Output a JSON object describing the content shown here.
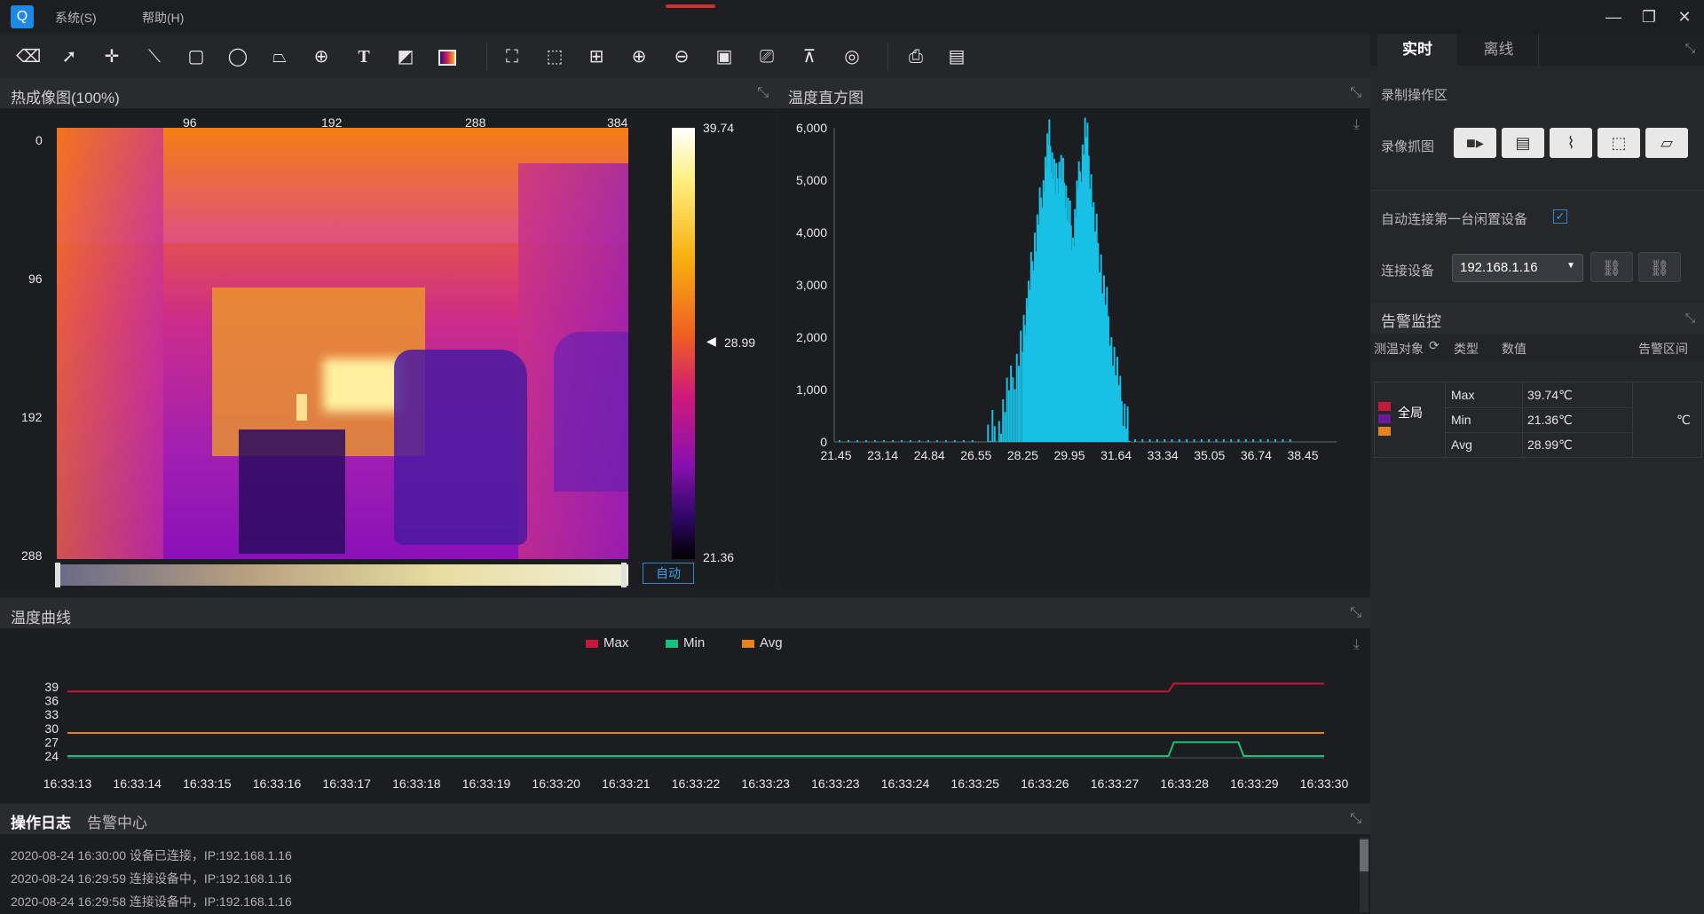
{
  "menu": {
    "system": "系统(S)",
    "help": "帮助(H)"
  },
  "window_controls": {
    "minimize": "—",
    "restore": "❐",
    "close": "✕"
  },
  "thermal": {
    "title": "热成像图(100%)",
    "x_ticks": [
      "96",
      "192",
      "288",
      "384"
    ],
    "y_ticks": [
      "0",
      "96",
      "192",
      "288"
    ],
    "scale_max": "39.74",
    "scale_cursor": "28.99",
    "scale_min": "21.36",
    "auto_button": "自动"
  },
  "histogram": {
    "title": "温度直方图",
    "y_ticks": [
      "6,000",
      "5,000",
      "4,000",
      "3,000",
      "2,000",
      "1,000",
      "0"
    ],
    "x_ticks": [
      "21.45",
      "23.14",
      "24.84",
      "26.55",
      "28.25",
      "29.95",
      "31.64",
      "33.34",
      "35.05",
      "36.74",
      "38.45"
    ]
  },
  "curve": {
    "title": "温度曲线",
    "legend": [
      {
        "name": "Max",
        "color": "#c8173a"
      },
      {
        "name": "Min",
        "color": "#14c47a"
      },
      {
        "name": "Avg",
        "color": "#e8821a"
      }
    ],
    "y_ticks": [
      "39",
      "36",
      "33",
      "30",
      "27",
      "24"
    ],
    "x_ticks": [
      "16:33:13",
      "16:33:14",
      "16:33:15",
      "16:33:16",
      "16:33:17",
      "16:33:18",
      "16:33:19",
      "16:33:20",
      "16:33:21",
      "16:33:22",
      "16:33:23",
      "16:33:23",
      "16:33:24",
      "16:33:25",
      "16:33:26",
      "16:33:27",
      "16:33:28",
      "16:33:29",
      "16:33:30"
    ]
  },
  "log": {
    "tab_active": "操作日志",
    "tab_other": "告警中心",
    "lines": [
      "2020-08-24 16:30:00 设备已连接，IP:192.168.1.16",
      "2020-08-24 16:29:59 连接设备中，IP:192.168.1.16",
      "2020-08-24 16:29:58 连接设备中，IP:192.168.1.16"
    ]
  },
  "right": {
    "tab_realtime": "实时",
    "tab_offline": "离线",
    "record_area": "录制操作区",
    "capture_label": "录像抓图",
    "auto_connect": "自动连接第一台闲置设备",
    "connect_label": "连接设备",
    "device_ip": "192.168.1.16",
    "alarm_title": "告警监控",
    "alarm_headers": {
      "target": "测温对象",
      "type": "类型",
      "value": "数值",
      "range": "告警区间"
    },
    "alarm_target": "全局",
    "alarm_rows": [
      {
        "type": "Max",
        "value": "39.74℃"
      },
      {
        "type": "Min",
        "value": "21.36℃"
      },
      {
        "type": "Avg",
        "value": "28.99℃"
      }
    ],
    "alarm_unit": "℃"
  },
  "chart_data": [
    {
      "type": "bar",
      "title": "温度直方图",
      "x_range": [
        21.45,
        38.45
      ],
      "ylim": [
        0,
        6000
      ],
      "x": [
        26.55,
        27.0,
        27.4,
        27.8,
        28.0,
        28.25,
        28.5,
        28.7,
        28.9,
        29.1,
        29.3,
        29.5,
        29.7,
        29.95,
        30.2,
        30.5,
        30.8,
        31.1,
        31.4
      ],
      "values": [
        100,
        400,
        1100,
        1900,
        2900,
        4000,
        5000,
        5800,
        4900,
        5300,
        4600,
        3900,
        5000,
        6000,
        4400,
        3200,
        2000,
        900,
        200
      ]
    },
    {
      "type": "line",
      "title": "温度曲线",
      "categories": [
        "16:33:13",
        "16:33:14",
        "16:33:15",
        "16:33:16",
        "16:33:17",
        "16:33:18",
        "16:33:19",
        "16:33:20",
        "16:33:21",
        "16:33:22",
        "16:33:23",
        "16:33:23",
        "16:33:24",
        "16:33:25",
        "16:33:26",
        "16:33:27",
        "16:33:28",
        "16:33:29",
        "16:33:30"
      ],
      "ylim": [
        24,
        39
      ],
      "series": [
        {
          "name": "Max",
          "values": [
            38.0,
            38.0,
            38.0,
            38.0,
            38.0,
            38.0,
            38.0,
            38.0,
            38.0,
            38.0,
            38.0,
            38.0,
            38.0,
            38.0,
            38.0,
            38.0,
            39.7,
            39.7,
            39.7
          ]
        },
        {
          "name": "Min",
          "values": [
            24.0,
            24.0,
            24.0,
            24.0,
            24.0,
            24.0,
            24.0,
            24.0,
            24.0,
            24.0,
            24.0,
            24.0,
            24.0,
            24.0,
            24.0,
            24.0,
            27.0,
            24.0,
            24.0
          ]
        },
        {
          "name": "Avg",
          "values": [
            29.0,
            29.0,
            29.0,
            29.0,
            29.0,
            29.0,
            29.0,
            29.0,
            29.0,
            29.0,
            29.0,
            29.0,
            29.0,
            29.0,
            29.0,
            29.0,
            29.0,
            29.0,
            29.0
          ]
        }
      ]
    }
  ]
}
